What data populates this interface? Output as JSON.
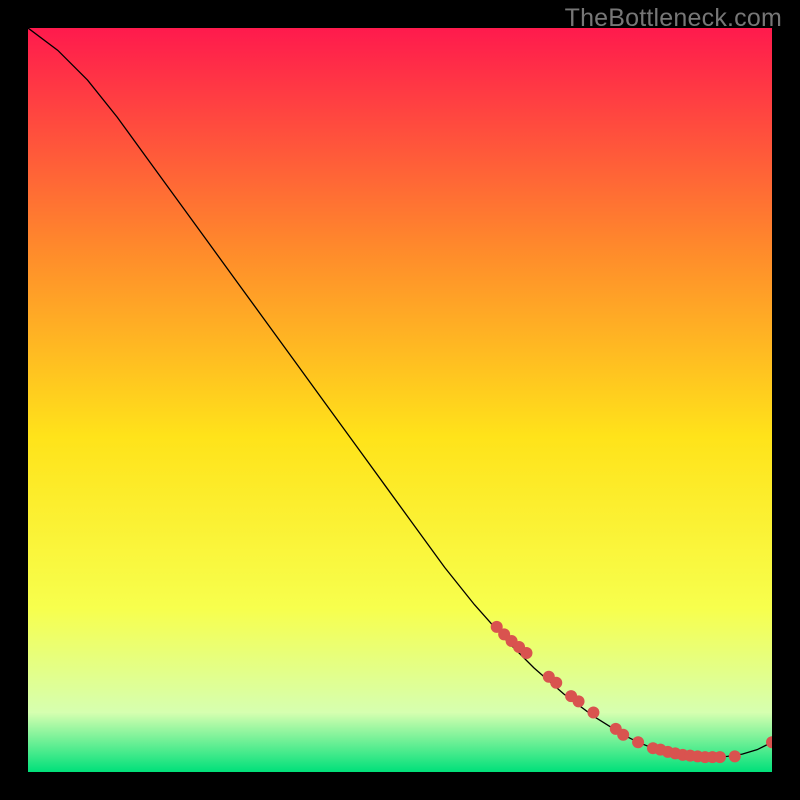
{
  "watermark": "TheBottleneck.com",
  "chart_data": {
    "type": "line",
    "title": "",
    "xlabel": "",
    "ylabel": "",
    "xlim": [
      0,
      100
    ],
    "ylim": [
      0,
      100
    ],
    "grid": false,
    "legend": false,
    "background_gradient": {
      "top": "#ff1a4d",
      "mid_upper": "#ff8b2b",
      "mid": "#ffe31a",
      "mid_lower": "#f7ff4d",
      "near_bottom": "#d6ffb0",
      "bottom": "#00e07a"
    },
    "series": [
      {
        "name": "bottleneck-curve",
        "color": "#000000",
        "stroke_width": 1.3,
        "x": [
          0,
          4,
          8,
          12,
          16,
          20,
          24,
          28,
          32,
          36,
          40,
          44,
          48,
          52,
          56,
          60,
          64,
          68,
          72,
          76,
          80,
          82,
          84,
          86,
          88,
          90,
          92,
          94,
          96,
          98,
          100
        ],
        "y": [
          100,
          97,
          93,
          88,
          82.5,
          77,
          71.5,
          66,
          60.5,
          55,
          49.5,
          44,
          38.5,
          33,
          27.5,
          22.5,
          18,
          14,
          10.5,
          7.5,
          5,
          4,
          3.2,
          2.6,
          2.2,
          2,
          2,
          2.1,
          2.4,
          3.0,
          4.0
        ]
      }
    ],
    "scatter": {
      "name": "sample-points",
      "color": "#d9534f",
      "radius": 6,
      "x": [
        63,
        64,
        65,
        66,
        67,
        70,
        71,
        73,
        74,
        76,
        79,
        80,
        82,
        84,
        85,
        86,
        87,
        88,
        89,
        90,
        91,
        92,
        93,
        95,
        100
      ],
      "y": [
        19.5,
        18.5,
        17.6,
        16.8,
        16.0,
        12.8,
        12.0,
        10.2,
        9.5,
        8.0,
        5.8,
        5.0,
        4.0,
        3.2,
        3.0,
        2.7,
        2.5,
        2.3,
        2.2,
        2.1,
        2.0,
        2.0,
        2.0,
        2.1,
        4.0
      ]
    }
  }
}
